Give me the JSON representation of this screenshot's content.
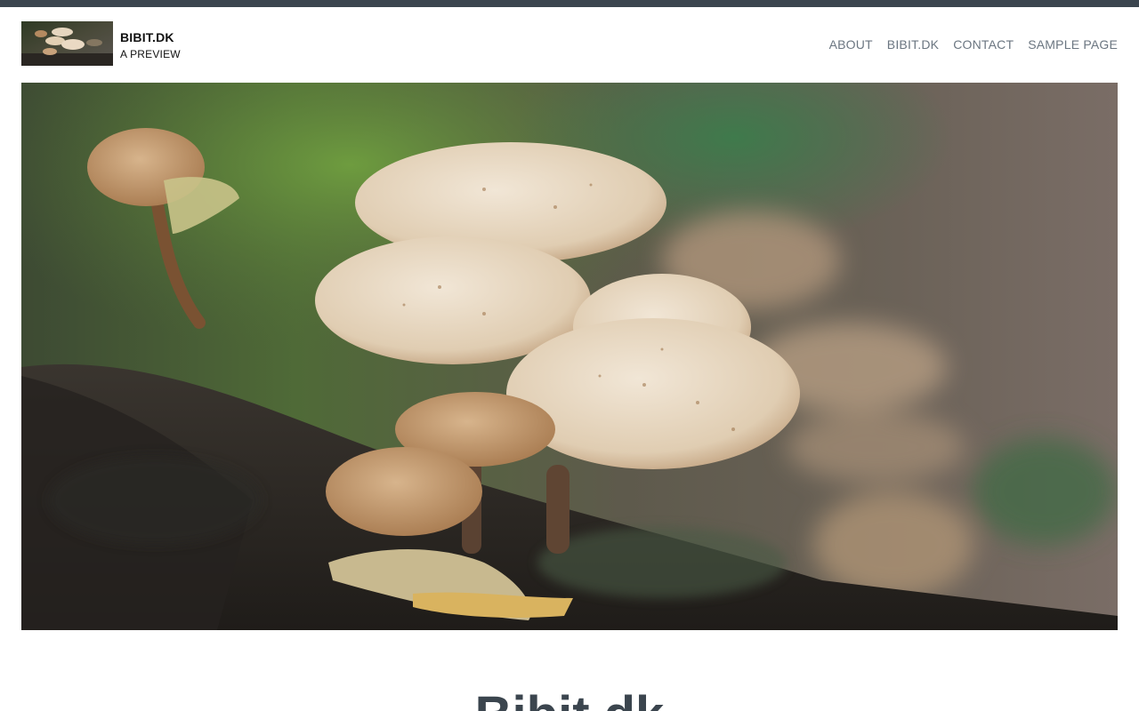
{
  "site": {
    "title": "BIBIT.DK",
    "tagline": "A PREVIEW",
    "logo_icon": "mushroom-photo-thumbnail"
  },
  "nav": {
    "items": [
      {
        "label": "ABOUT"
      },
      {
        "label": "BIBIT.DK"
      },
      {
        "label": "CONTACT"
      },
      {
        "label": "SAMPLE PAGE"
      }
    ]
  },
  "hero": {
    "image": "mushroom-cluster-photo"
  },
  "post": {
    "title_partial": "Bibit.dk"
  },
  "colors": {
    "top_bar": "#3b454e",
    "nav_text": "#6b7681",
    "title_text": "#3b454e"
  }
}
